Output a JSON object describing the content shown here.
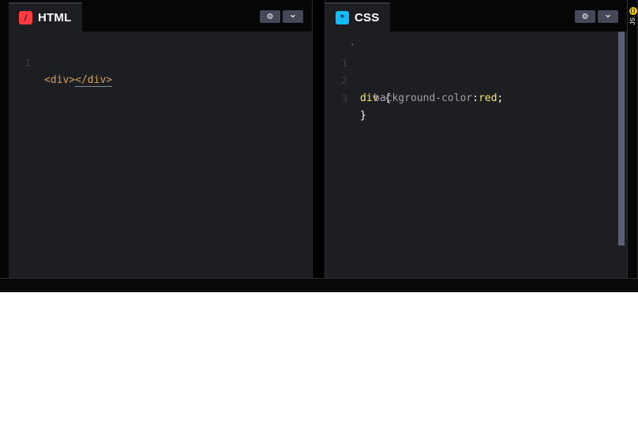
{
  "html_panel": {
    "title": "HTML",
    "icon": "html-slash-icon",
    "icon_glyph": "/",
    "accent": "#ff3c41",
    "lines": [
      {
        "number": "1",
        "content": [
          "<div>",
          "</div>"
        ]
      }
    ]
  },
  "css_panel": {
    "title": "CSS",
    "icon": "css-asterisk-icon",
    "icon_glyph": "*",
    "accent": "#0ebeff",
    "lines": [
      {
        "number": "1",
        "selector": "div",
        "brace": "{"
      },
      {
        "number": "2",
        "property": "background-color",
        "colon": ":",
        "value": "red",
        "semi": ";"
      },
      {
        "number": "3",
        "brace": "}"
      }
    ]
  },
  "js_panel": {
    "title": "JS",
    "icon_glyph": "()",
    "accent": "#fcd000"
  },
  "buttons": {
    "settings_icon": "gear-icon",
    "settings_glyph": "⚙",
    "collapse_icon": "chevron-down-icon",
    "collapse_glyph": "⌄"
  },
  "colors": {
    "editor_bg": "#1d1e22",
    "header_bg": "#060606",
    "button_bg": "#444857",
    "selector": "#fce566",
    "tag": "#d0a05a",
    "property": "#a69fa6"
  }
}
